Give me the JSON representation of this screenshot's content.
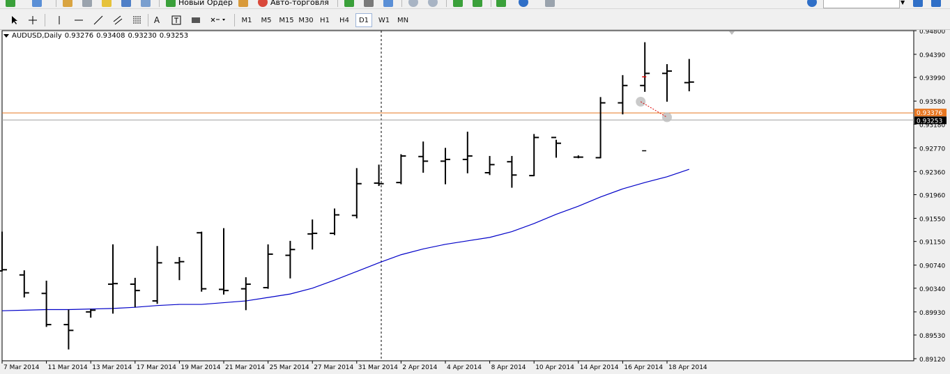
{
  "toolbar_top": {
    "new_order_label": "Новый Ордер",
    "autotrading_label": "Авто-торговля"
  },
  "toolbar_timeframes": {
    "buttons": [
      "M1",
      "M5",
      "M15",
      "M30",
      "H1",
      "H4",
      "D1",
      "W1",
      "MN"
    ],
    "selected": "D1"
  },
  "chart": {
    "symbol_tf": "AUDUSD,Daily",
    "open": "0.93276",
    "high": "0.93408",
    "low": "0.93230",
    "close": "0.93253",
    "price_labels": [
      "0.94800",
      "0.94390",
      "0.93990",
      "0.93580",
      "0.93180",
      "0.92770",
      "0.92360",
      "0.91960",
      "0.91550",
      "0.91150",
      "0.90740",
      "0.90340",
      "0.89930",
      "0.89530",
      "0.89120"
    ],
    "date_labels": [
      "7 Mar 2014",
      "11 Mar 2014",
      "13 Mar 2014",
      "17 Mar 2014",
      "19 Mar 2014",
      "21 Mar 2014",
      "25 Mar 2014",
      "27 Mar 2014",
      "31 Mar 2014",
      "2 Apr 2014",
      "4 Apr 2014",
      "8 Apr 2014",
      "10 Apr 2014",
      "14 Apr 2014",
      "16 Apr 2014",
      "18 Apr 2014"
    ],
    "ask_line_label": "0.93376",
    "bid_line_label": "0.93253",
    "colors": {
      "ask_line": "#e87722",
      "bid_line": "#a0a0a0",
      "ma_line": "#0000c8",
      "bars": "#000000",
      "background": "#ffffff"
    }
  },
  "chart_data": {
    "type": "ohlc",
    "ylim": [
      0.8912,
      0.948
    ],
    "x": [
      "6 Mar",
      "7 Mar",
      "10 Mar",
      "11 Mar",
      "12 Mar",
      "13 Mar",
      "14 Mar",
      "17 Mar",
      "18 Mar",
      "19 Mar",
      "20 Mar",
      "21 Mar",
      "24 Mar",
      "25 Mar",
      "26 Mar",
      "27 Mar",
      "28 Mar",
      "31 Mar",
      "1 Apr",
      "2 Apr",
      "3 Apr",
      "4 Apr",
      "7 Apr",
      "8 Apr",
      "9 Apr",
      "10 Apr",
      "11 Apr",
      "14 Apr",
      "15 Apr",
      "16 Apr",
      "17 Apr",
      "18 Apr"
    ],
    "series": [
      {
        "ohlc": [
          [
            0.9064,
            0.9132,
            0.9063,
            0.9066
          ],
          [
            0.9057,
            0.9065,
            0.9018,
            0.9026
          ],
          [
            0.9025,
            0.9047,
            0.8967,
            0.8971
          ],
          [
            0.8971,
            0.8997,
            0.8928,
            0.8961
          ],
          [
            0.8993,
            0.8998,
            0.8983,
            0.8996
          ],
          [
            0.9041,
            0.911,
            0.899,
            0.9042
          ],
          [
            0.9041,
            0.9052,
            0.9001,
            0.903
          ],
          [
            0.9012,
            0.9107,
            0.9007,
            0.9078
          ],
          [
            0.9078,
            0.9088,
            0.9048,
            0.908
          ],
          [
            0.913,
            0.9132,
            0.9028,
            0.9033
          ],
          [
            0.9032,
            0.9138,
            0.9023,
            0.903
          ],
          [
            0.9033,
            0.9053,
            0.8996,
            0.9041
          ],
          [
            0.9035,
            0.911,
            0.9033,
            0.9093
          ],
          [
            0.9091,
            0.9116,
            0.9051,
            0.9101
          ],
          [
            0.9128,
            0.9153,
            0.9101,
            0.9129
          ],
          [
            0.9129,
            0.9172,
            0.9126,
            0.9161
          ],
          [
            0.916,
            0.9242,
            0.9155,
            0.9215
          ],
          [
            0.9216,
            0.9248,
            0.9211,
            0.9215
          ],
          [
            0.9217,
            0.9266,
            0.9214,
            0.9263
          ],
          [
            0.9262,
            0.9288,
            0.9234,
            0.9254
          ],
          [
            0.9254,
            0.9277,
            0.9214,
            0.9257
          ],
          [
            0.9257,
            0.9305,
            0.9233,
            0.9263
          ],
          [
            0.9234,
            0.9263,
            0.923,
            0.9248
          ],
          [
            0.9253,
            0.9263,
            0.9208,
            0.923
          ],
          [
            0.9229,
            0.9301,
            0.9228,
            0.9295
          ],
          [
            0.9295,
            0.9291,
            0.926,
            0.9285
          ],
          [
            0.9261,
            0.9264,
            0.9259,
            0.9261
          ],
          [
            0.926,
            0.9365,
            0.9259,
            0.9355
          ],
          [
            0.9355,
            0.9403,
            0.9335,
            0.9385
          ],
          [
            0.9385,
            0.946,
            0.9374,
            0.9406
          ],
          [
            0.9406,
            0.9422,
            0.9357,
            0.941
          ],
          [
            0.939,
            0.9431,
            0.9375,
            0.9391
          ]
        ]
      }
    ]
  }
}
